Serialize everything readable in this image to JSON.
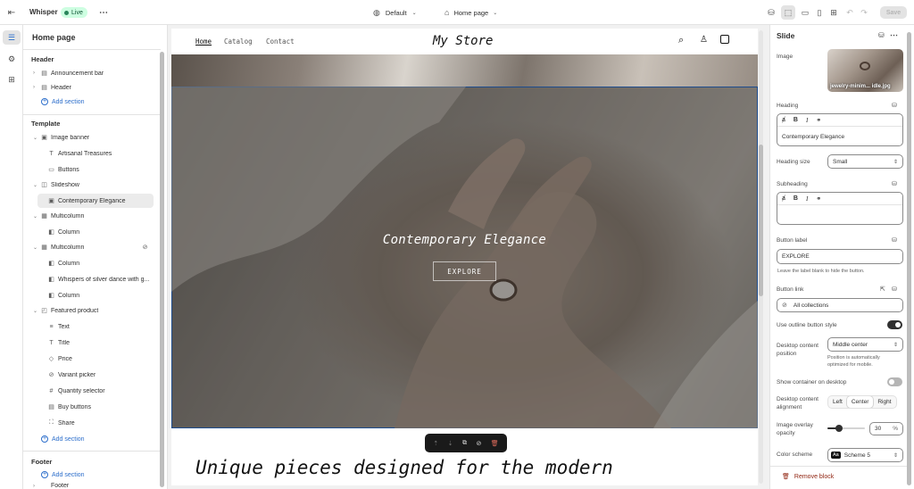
{
  "topbar": {
    "app_name": "Whisper",
    "live_badge": "Live",
    "theme_dropdown": "Default",
    "page_dropdown": "Home page",
    "save_label": "Save"
  },
  "left": {
    "title": "Home page",
    "header_section": "Header",
    "header_items": [
      "Announcement bar",
      "Header"
    ],
    "add_section": "Add section",
    "template_section": "Template",
    "tree": [
      "Image banner",
      "Artisanal Treasures",
      "Buttons",
      "Slideshow",
      "Contemporary Elegance",
      "Multicolumn",
      "Column",
      "Multicolumn",
      "Column",
      "Whispers of silver dance with g...",
      "Column",
      "Featured product",
      "Text",
      "Title",
      "Price",
      "Variant picker",
      "Quantity selector",
      "Buy buttons",
      "Share"
    ],
    "footer_section": "Footer",
    "footer_item": "Footer"
  },
  "store": {
    "nav": [
      "Home",
      "Catalog",
      "Contact"
    ],
    "logo": "My Store",
    "banner_heading": "Contemporary Elegance",
    "banner_button": "EXPLORE",
    "next_heading": "Unique pieces designed for the modern"
  },
  "right": {
    "title": "Slide",
    "image_label": "Image",
    "image_filename": "jewelry-minim... idle.jpg",
    "heading_label": "Heading",
    "heading_value": "Contemporary Elegance",
    "heading_size_label": "Heading size",
    "heading_size_value": "Small",
    "subheading_label": "Subheading",
    "subheading_value": "",
    "button_label_label": "Button label",
    "button_label_value": "EXPLORE",
    "button_label_help": "Leave the label blank to hide the button.",
    "button_link_label": "Button link",
    "button_link_value": "All collections",
    "outline_label": "Use outline button style",
    "outline_on": true,
    "position_label": "Desktop content position",
    "position_value": "Middle center",
    "position_help": "Position is automatically optimized for mobile.",
    "container_label": "Show container on desktop",
    "container_on": false,
    "alignment_label": "Desktop content alignment",
    "alignment_options": [
      "Left",
      "Center",
      "Right"
    ],
    "alignment_selected": "Center",
    "overlay_label": "Image overlay opacity",
    "overlay_value": "30",
    "overlay_unit": "%",
    "overlay_fraction": 0.3,
    "scheme_label": "Color scheme",
    "scheme_badge": "Aa",
    "scheme_value": "Scheme 5",
    "remove_label": "Remove block"
  },
  "colors": {
    "accent": "#2c6ecb",
    "live_green": "#29845a",
    "selected_bg": "#ebebeb",
    "danger": "#8e1f0b"
  }
}
